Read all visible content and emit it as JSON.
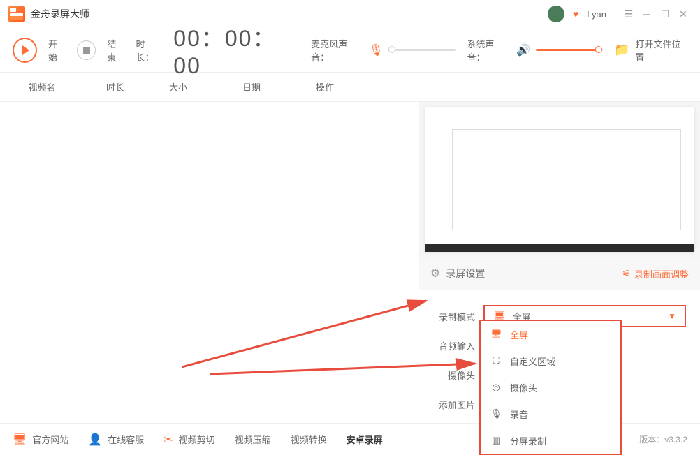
{
  "app": {
    "title": "金舟录屏大师",
    "username": "Lyan"
  },
  "toolbar": {
    "start": "开始",
    "stop": "结束",
    "duration_label": "时长：",
    "duration_value": "00：00：00",
    "mic_label": "麦克风声音：",
    "system_sound_label": "系统声音：",
    "open_folder": "打开文件位置"
  },
  "table": {
    "name": "视频名",
    "duration": "时长",
    "size": "大小",
    "date": "日期",
    "operation": "操作"
  },
  "settings": {
    "header": "录屏设置",
    "adjust": "录制画面调整",
    "mode_label": "录制模式",
    "audio_label": "音频输入",
    "camera_label": "摄像头",
    "image_label": "添加图片",
    "selected_mode": "全屏"
  },
  "dropdown": {
    "items": [
      {
        "icon": "🖥",
        "label": "全屏",
        "active": true
      },
      {
        "icon": "⛶",
        "label": "自定义区域",
        "active": false
      },
      {
        "icon": "◎",
        "label": "摄像头",
        "active": false
      },
      {
        "icon": "🎙",
        "label": "录音",
        "active": false
      },
      {
        "icon": "▥",
        "label": "分屏录制",
        "active": false
      }
    ]
  },
  "footer": {
    "website": "官方网站",
    "support": "在线客服",
    "video_cut": "视频剪切",
    "video_compress": "视频压缩",
    "video_convert": "视频转换",
    "android_record": "安卓录屏",
    "version_label": "版本：",
    "version": "v3.3.2"
  }
}
